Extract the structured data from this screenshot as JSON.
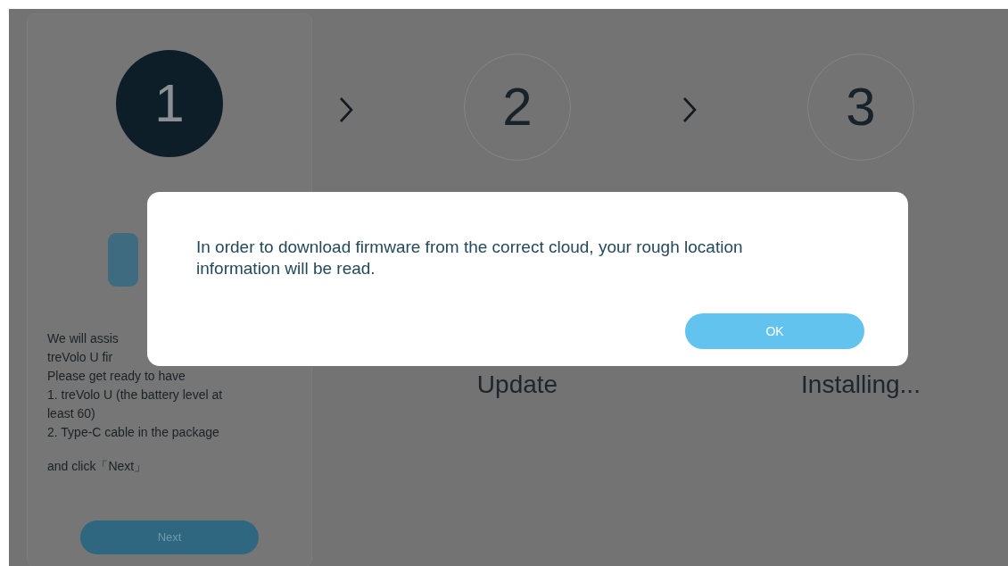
{
  "steps": [
    {
      "number": "1",
      "selected": true
    },
    {
      "number": "2",
      "selected": false,
      "label": "Update"
    },
    {
      "number": "3",
      "selected": false,
      "label": "Installing..."
    }
  ],
  "instructions": [
    "We will assis",
    "treVolo U fir",
    "Please get ready to have",
    "1. treVolo U (the battery level at least 60)",
    "2. Type-C cable in the package",
    "and click「Next」"
  ],
  "next_button": "Next",
  "dialog": {
    "message": "In order to download firmware from the correct cloud, your rough location information will be read.",
    "ok_button": "OK"
  }
}
